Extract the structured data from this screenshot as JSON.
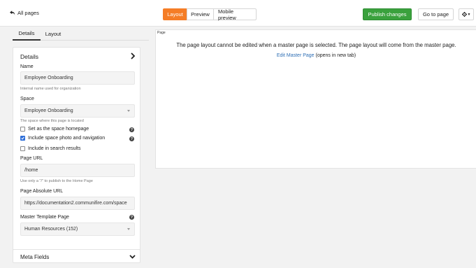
{
  "topbar": {
    "back_label": "All pages",
    "view_modes": [
      "Layout",
      "Preview",
      "Mobile preview"
    ],
    "publish_label": "Publish changes",
    "goto_label": "Go to page"
  },
  "sidebar": {
    "tabs": [
      "Details",
      "Layout"
    ],
    "details": {
      "title": "Details",
      "name": {
        "label": "Name",
        "value": "Employee Onboarding",
        "help": "Internal name used for organization"
      },
      "space": {
        "label": "Space",
        "value": "Employee Onboarding",
        "help": "The space where this page is located"
      },
      "checkboxes": [
        {
          "label": "Set as the space homepage",
          "checked": false
        },
        {
          "label": "Include space photo and navigation",
          "checked": true
        },
        {
          "label": "Include in search results",
          "checked": false
        }
      ],
      "page_url": {
        "label": "Page URL",
        "value": "/home",
        "help": "Use only a \"/\" to publish to the Home Page"
      },
      "absolute_url": {
        "label": "Page Absolute URL",
        "value": "https://documentation2.communifire.com/space"
      },
      "master_template": {
        "label": "Master Template Page",
        "value": "Human Resources (152)"
      }
    },
    "meta_fields": {
      "title": "Meta Fields"
    }
  },
  "canvas": {
    "tag": "Page",
    "message": "The page layout cannot be edited when a master page is selected. The page layout will come from the master page.",
    "edit_link": "Edit Master Page",
    "edit_note": " (opens in new tab)"
  },
  "colors": {
    "accent": "#f57d26",
    "publish": "#3aa13d",
    "link": "#2f6fb5",
    "checkbox": "#2f6fd8"
  }
}
